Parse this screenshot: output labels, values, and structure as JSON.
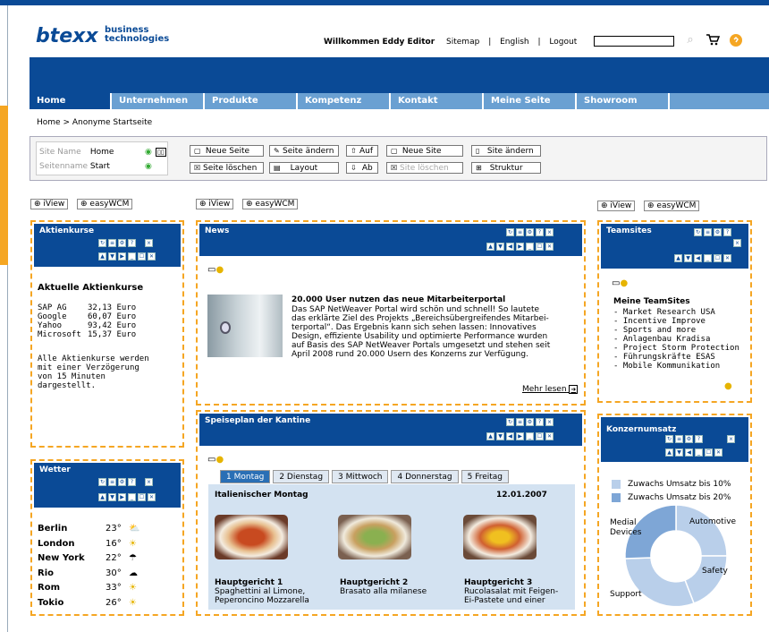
{
  "header": {
    "brand": "btexx",
    "brand_sub1": "business",
    "brand_sub2": "technologies",
    "welcome": "Willkommen Eddy Editor",
    "links": [
      "Sitemap",
      "English",
      "Logout"
    ],
    "search_value": ""
  },
  "nav": [
    "Home",
    "Unternehmen",
    "Produkte",
    "Kompetenz",
    "Kontakt",
    "Meine Seite",
    "Showroom"
  ],
  "breadcrumb": "Home > Anonyme Startseite",
  "edit": {
    "site_name_label": "Site Name",
    "site_name_value": "Home",
    "page_name_label": "Seitenname",
    "page_name_value": "Start",
    "buttons_row1": [
      "Neue Seite",
      "Seite ändern",
      "Auf",
      "Neue Site",
      "Site ändern"
    ],
    "buttons_row2": [
      "Seite löschen",
      "Layout",
      "Ab",
      "Site löschen",
      "Struktur"
    ]
  },
  "column_tabs": {
    "iview": "iView",
    "easywcm": "easyWCM"
  },
  "aktien": {
    "title": "Aktienkurse",
    "heading": "Aktuelle Aktienkurse",
    "rows": [
      {
        "name": "SAP AG",
        "value": "32,13 Euro"
      },
      {
        "name": "Google",
        "value": "60,07 Euro"
      },
      {
        "name": "Yahoo",
        "value": "93,42 Euro"
      },
      {
        "name": "Microsoft",
        "value": "15,37 Euro"
      }
    ],
    "note1": "Alle Aktienkurse werden",
    "note2": "mit einer Verzögerung",
    "note3": "von 15 Minuten",
    "note4": "dargestellt."
  },
  "wetter": {
    "title": "Wetter",
    "rows": [
      {
        "city": "Berlin",
        "temp": "23°"
      },
      {
        "city": "London",
        "temp": "16°"
      },
      {
        "city": "New York",
        "temp": "22°"
      },
      {
        "city": "Rio",
        "temp": "30°"
      },
      {
        "city": "Rom",
        "temp": "33°"
      },
      {
        "city": "Tokio",
        "temp": "26°"
      }
    ]
  },
  "news": {
    "title": "News",
    "headline": "20.000 User nutzen das neue Mitarbeiterportal",
    "lines": [
      "Das SAP NetWeaver Portal wird schön und schnell! So lautete",
      "das erklärte Ziel des Projekts „Bereichsübergreifendes Mitarbei-",
      "terportal“. Das Ergebnis kann sich sehen lassen: Innovatives",
      "Design, effiziente Usability und optimierte Performance wurden",
      "auf Basis des SAP NetWeaver Portals umgesetzt und stehen seit",
      "April 2008 rund 20.000 Usern des Konzerns zur Verfügung."
    ],
    "more": "Mehr lesen"
  },
  "speiseplan": {
    "title": "Speiseplan der Kantine",
    "tabs": [
      "1 Montag",
      "2 Dienstag",
      "3 Mittwoch",
      "4 Donnerstag",
      "5 Freitag"
    ],
    "day_title": "Italienischer Montag",
    "date": "12.01.2007",
    "dishes": [
      {
        "label": "Hauptgericht 1",
        "line1": "Spaghettini al Limone,",
        "line2": "Peperoncino Mozzarella"
      },
      {
        "label": "Hauptgericht 2",
        "line1": "Brasato alla milanese",
        "line2": ""
      },
      {
        "label": "Hauptgericht 3",
        "line1": "Rucolasalat mit Feigen-",
        "line2": "Ei-Pastete und einer"
      }
    ]
  },
  "teamsites": {
    "title": "Teamsites",
    "heading": "Meine TeamSites",
    "items": [
      "- Market Research USA",
      "- Incentive Improve",
      "- Sports and more",
      "- Anlagenbau Kradisa",
      "- Project Storm Protection",
      "- Führungskräfte ESAS",
      "- Mobile Kommunikation"
    ]
  },
  "umsatz": {
    "title": "Konzernumsatz",
    "legend": [
      {
        "label": "Zuwachs Umsatz bis 10%",
        "color": "#b9cfea"
      },
      {
        "label": "Zuwachs Umsatz bis 20%",
        "color": "#7ea6d6"
      }
    ],
    "labels": {
      "medial1": "Medial",
      "medial2": "Devices",
      "automotive": "Automotive",
      "safety": "Safety",
      "support": "Support"
    }
  },
  "colors": {
    "brand": "#0a4a96",
    "nav": "#6aa0d2",
    "accent": "#f5a623"
  }
}
